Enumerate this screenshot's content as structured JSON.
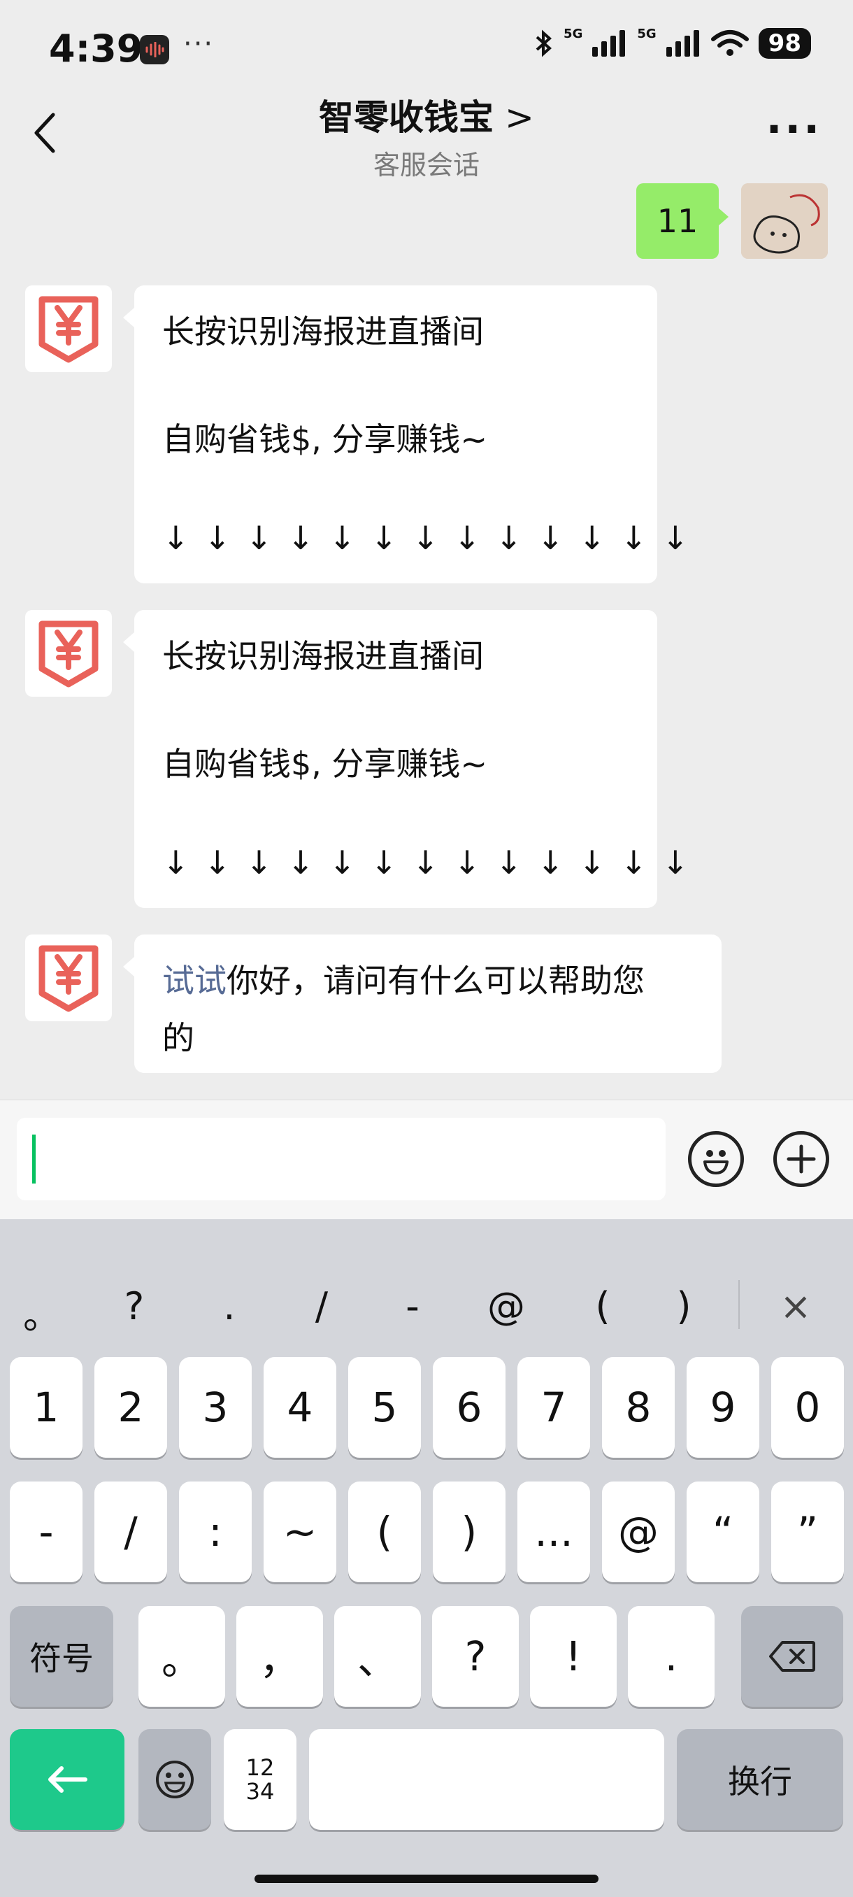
{
  "status_bar": {
    "time": "4:39",
    "more_dots": "···",
    "battery": "98",
    "signal1": "5G",
    "signal2": "5G"
  },
  "nav": {
    "title": "智零收钱宝",
    "chevron": ">",
    "subtitle": "客服会话",
    "more": "···"
  },
  "messages": {
    "sent": {
      "text": "11"
    },
    "bot1": {
      "line1": "长按识别海报进直播间",
      "line2": "自购省钱$, 分享赚钱~",
      "arrows": "↓↓↓↓↓↓↓↓↓↓↓↓↓"
    },
    "bot2": {
      "line1": "长按识别海报进直播间",
      "line2": "自购省钱$, 分享赚钱~",
      "arrows": "↓↓↓↓↓↓↓↓↓↓↓↓↓"
    },
    "bot3": {
      "link": "试试",
      "line1_rest": "你好，请问有什么可以帮助您",
      "line2": "的"
    }
  },
  "colors": {
    "accent_green": "#07c160",
    "bubble_green": "#95ec69",
    "avatar_red": "#e9625a",
    "link_blue": "#576b95"
  },
  "keyboard": {
    "symbols": [
      "。",
      "?",
      ".",
      "/",
      "-",
      "@",
      "(",
      ")"
    ],
    "close": "×",
    "row1": [
      "1",
      "2",
      "3",
      "4",
      "5",
      "6",
      "7",
      "8",
      "9",
      "0"
    ],
    "row2": [
      "-",
      "/",
      ":",
      "~",
      "(",
      ")",
      "...",
      "@",
      "“",
      "”"
    ],
    "row3_left": "符号",
    "row3": [
      "。",
      "，",
      "、",
      "?",
      "!",
      "."
    ],
    "row4_num_top": "12",
    "row4_num_bottom": "34",
    "enter": "换行"
  }
}
